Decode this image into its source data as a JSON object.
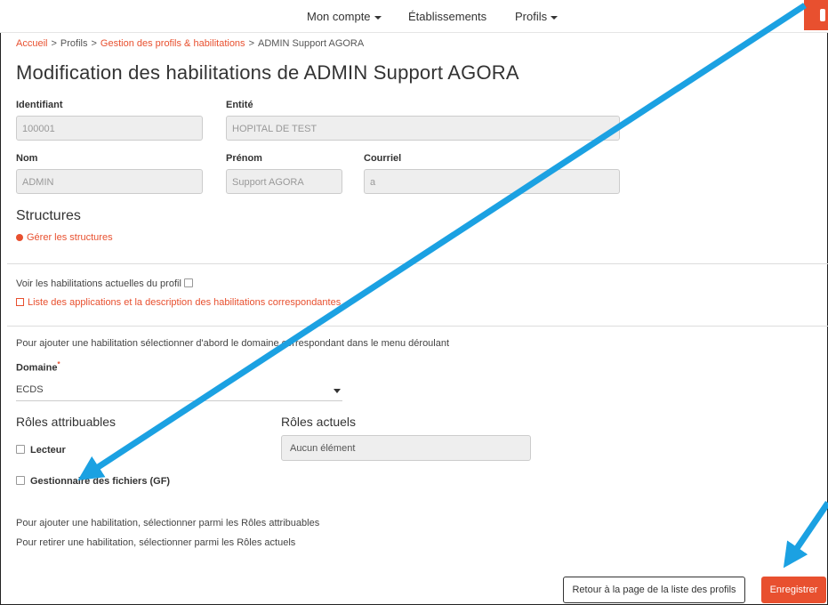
{
  "nav": {
    "account": "Mon compte",
    "establishments": "Établissements",
    "profiles": "Profils"
  },
  "breadcrumb": {
    "home": "Accueil",
    "profiles": "Profils",
    "management": "Gestion des profils & habilitations",
    "current": "ADMIN Support AGORA",
    "separator": ">"
  },
  "title": "Modification des habilitations de ADMIN Support AGORA",
  "form": {
    "identifier_label": "Identifiant",
    "identifier_value": "100001",
    "entity_label": "Entité",
    "entity_value": "HOPITAL DE TEST",
    "lastname_label": "Nom",
    "lastname_value": "ADMIN",
    "firstname_label": "Prénom",
    "firstname_value": "Support AGORA",
    "email_label": "Courriel",
    "email_value": "a"
  },
  "structures": {
    "title": "Structures",
    "manage_link": "Gérer les structures"
  },
  "habilitations": {
    "show_current_label": "Voir les habilitations actuelles du profil",
    "apps_link": "Liste des applications et la description des habilitations correspondantes",
    "instruction": "Pour ajouter une habilitation sélectionner d'abord le domaine correspondant dans le menu déroulant",
    "domain_label": "Domaine",
    "domain_required": "*",
    "domain_value": "ECDS",
    "assignable_title": "Rôles attribuables",
    "current_title": "Rôles actuels",
    "roles": [
      "Lecteur",
      "Gestionnaire des fichiers (GF)"
    ],
    "current_empty": "Aucun élément",
    "help_add": "Pour ajouter une habilitation, sélectionner parmi les Rôles attribuables",
    "help_remove": "Pour retirer une habilitation, sélectionner parmi les Rôles actuels"
  },
  "actions": {
    "back": "Retour à la page de la liste des profils",
    "save": "Enregistrer"
  },
  "colors": {
    "accent": "#e8502f",
    "annotation_arrow": "#1ba1e2"
  }
}
